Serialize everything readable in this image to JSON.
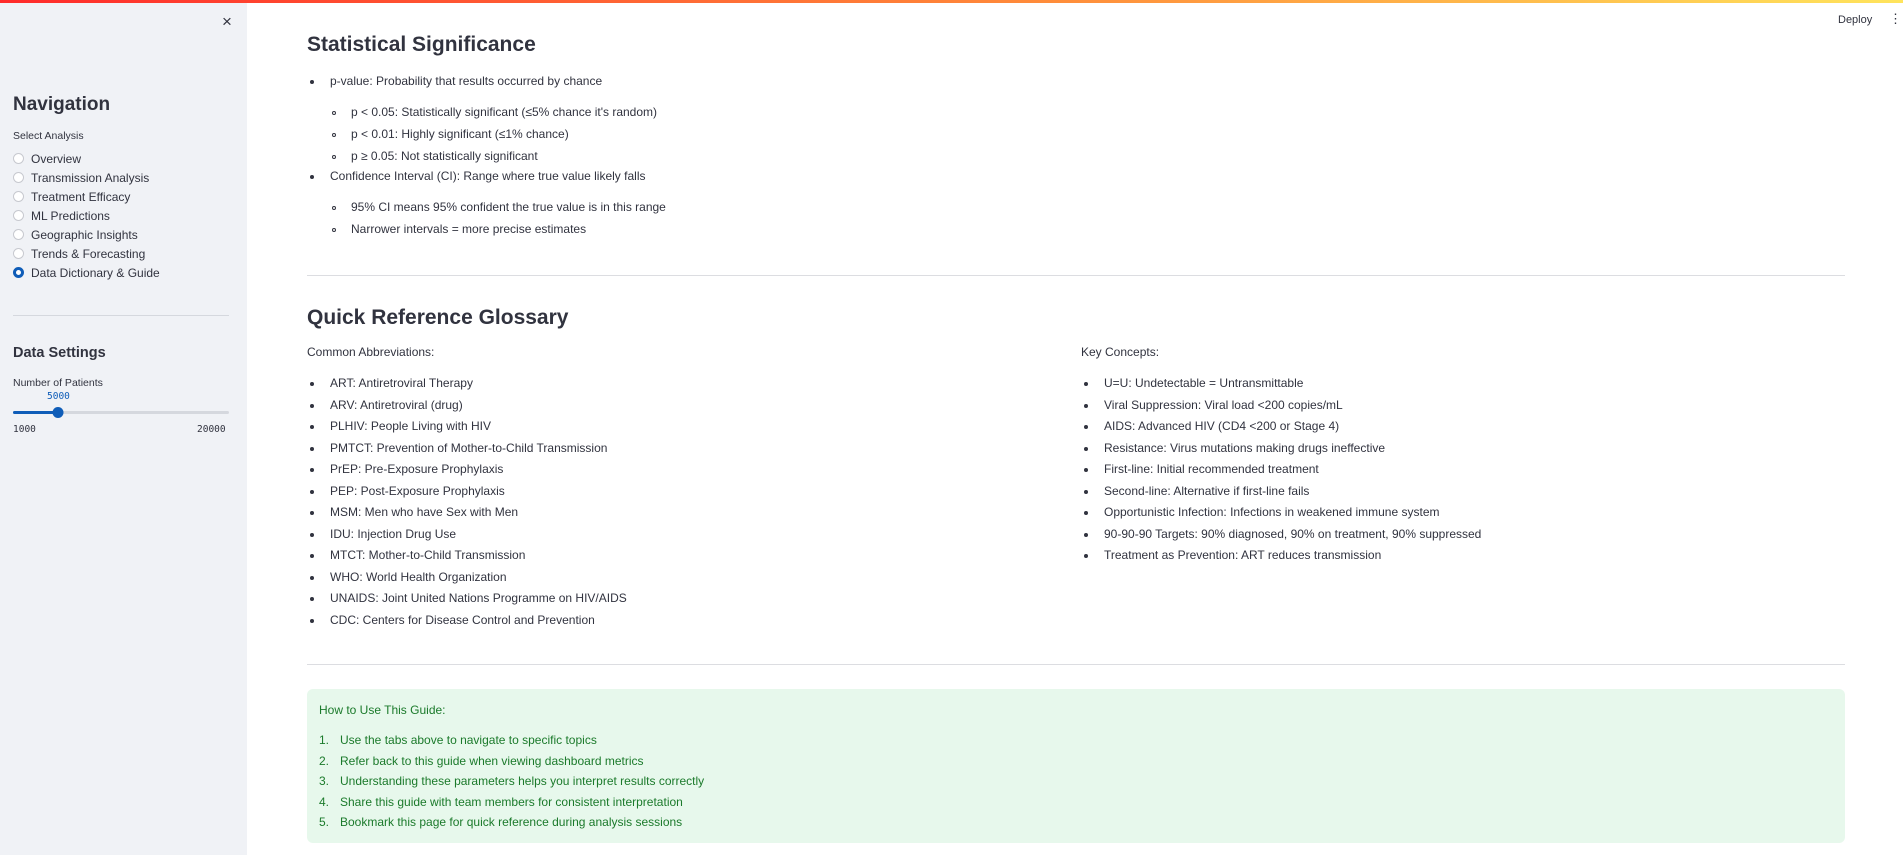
{
  "sidebar": {
    "close_icon": "×",
    "nav_title": "Navigation",
    "select_label": "Select Analysis",
    "options": [
      "Overview",
      "Transmission Analysis",
      "Treatment Efficacy",
      "ML Predictions",
      "Geographic Insights",
      "Trends & Forecasting",
      "Data Dictionary & Guide"
    ],
    "selected_option": "Data Dictionary & Guide",
    "settings_title": "Data Settings",
    "slider": {
      "label": "Number of Patients",
      "value": "5000",
      "min": "1000",
      "max": "20000",
      "value_number": 5000,
      "min_number": 1000,
      "max_number": 20000
    }
  },
  "header": {
    "deploy_label": "Deploy",
    "menu_icon": "⋮"
  },
  "stat_sig": {
    "title": "Statistical Significance",
    "pvalue": "p-value: Probability that results occurred by chance",
    "pvalue_items": [
      "p < 0.05: Statistically significant (≤5% chance it's random)",
      "p < 0.01: Highly significant (≤1% chance)",
      "p ≥ 0.05: Not statistically significant"
    ],
    "ci": "Confidence Interval (CI): Range where true value likely falls",
    "ci_items": [
      "95% CI means 95% confident the true value is in this range",
      "Narrower intervals = more precise estimates"
    ]
  },
  "glossary": {
    "title": "Quick Reference Glossary",
    "abbr_heading": "Common Abbreviations:",
    "abbreviations": [
      "ART: Antiretroviral Therapy",
      "ARV: Antiretroviral (drug)",
      "PLHIV: People Living with HIV",
      "PMTCT: Prevention of Mother-to-Child Transmission",
      "PrEP: Pre-Exposure Prophylaxis",
      "PEP: Post-Exposure Prophylaxis",
      "MSM: Men who have Sex with Men",
      "IDU: Injection Drug Use",
      "MTCT: Mother-to-Child Transmission",
      "WHO: World Health Organization",
      "UNAIDS: Joint United Nations Programme on HIV/AIDS",
      "CDC: Centers for Disease Control and Prevention"
    ],
    "concepts_heading": "Key Concepts:",
    "concepts": [
      "U=U: Undetectable = Untransmittable",
      "Viral Suppression: Viral load <200 copies/mL",
      "AIDS: Advanced HIV (CD4 <200 or Stage 4)",
      "Resistance: Virus mutations making drugs ineffective",
      "First-line: Initial recommended treatment",
      "Second-line: Alternative if first-line fails",
      "Opportunistic Infection: Infections in weakened immune system",
      "90-90-90 Targets: 90% diagnosed, 90% on treatment, 90% suppressed",
      "Treatment as Prevention: ART reduces transmission"
    ]
  },
  "guide": {
    "heading": "How to Use This Guide:",
    "steps": [
      "Use the tabs above to navigate to specific topics",
      "Refer back to this guide when viewing dashboard metrics",
      "Understanding these parameters helps you interpret results correctly",
      "Share this guide with team members for consistent interpretation",
      "Bookmark this page for quick reference during analysis sessions"
    ]
  },
  "colors": {
    "accent": "#0f5db8",
    "sidebar_bg": "#f0f2f6",
    "info_bg": "#e7f8ec",
    "info_text": "#1b7a2b"
  }
}
